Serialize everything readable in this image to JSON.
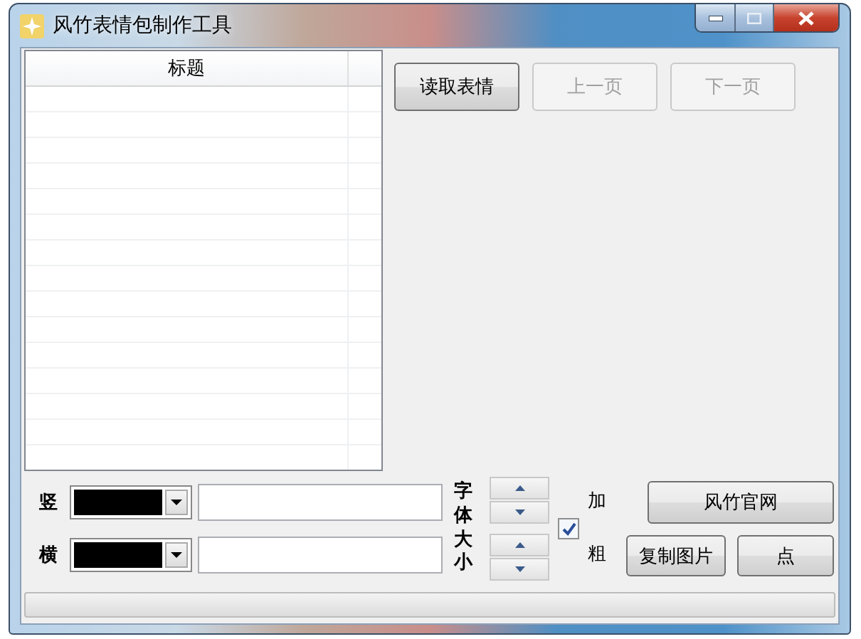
{
  "window": {
    "title": "风竹表情包制作工具"
  },
  "table": {
    "columns": [
      "标题"
    ]
  },
  "toolbar": [
    {
      "label": "读取表情",
      "disabled": false
    },
    {
      "label": "上一页",
      "disabled": true
    },
    {
      "label": "下一页",
      "disabled": true
    }
  ],
  "rows": [
    {
      "label": "竖",
      "color": "#000000"
    },
    {
      "label": "横",
      "color": "#000000"
    }
  ],
  "font_size_label": "字体大小",
  "bold": {
    "label": "加粗",
    "checked": true
  },
  "buttons": [
    {
      "label": "风竹官网"
    },
    {
      "label": "复制图片"
    },
    {
      "label": "点"
    }
  ],
  "progress": {
    "level": 0
  }
}
